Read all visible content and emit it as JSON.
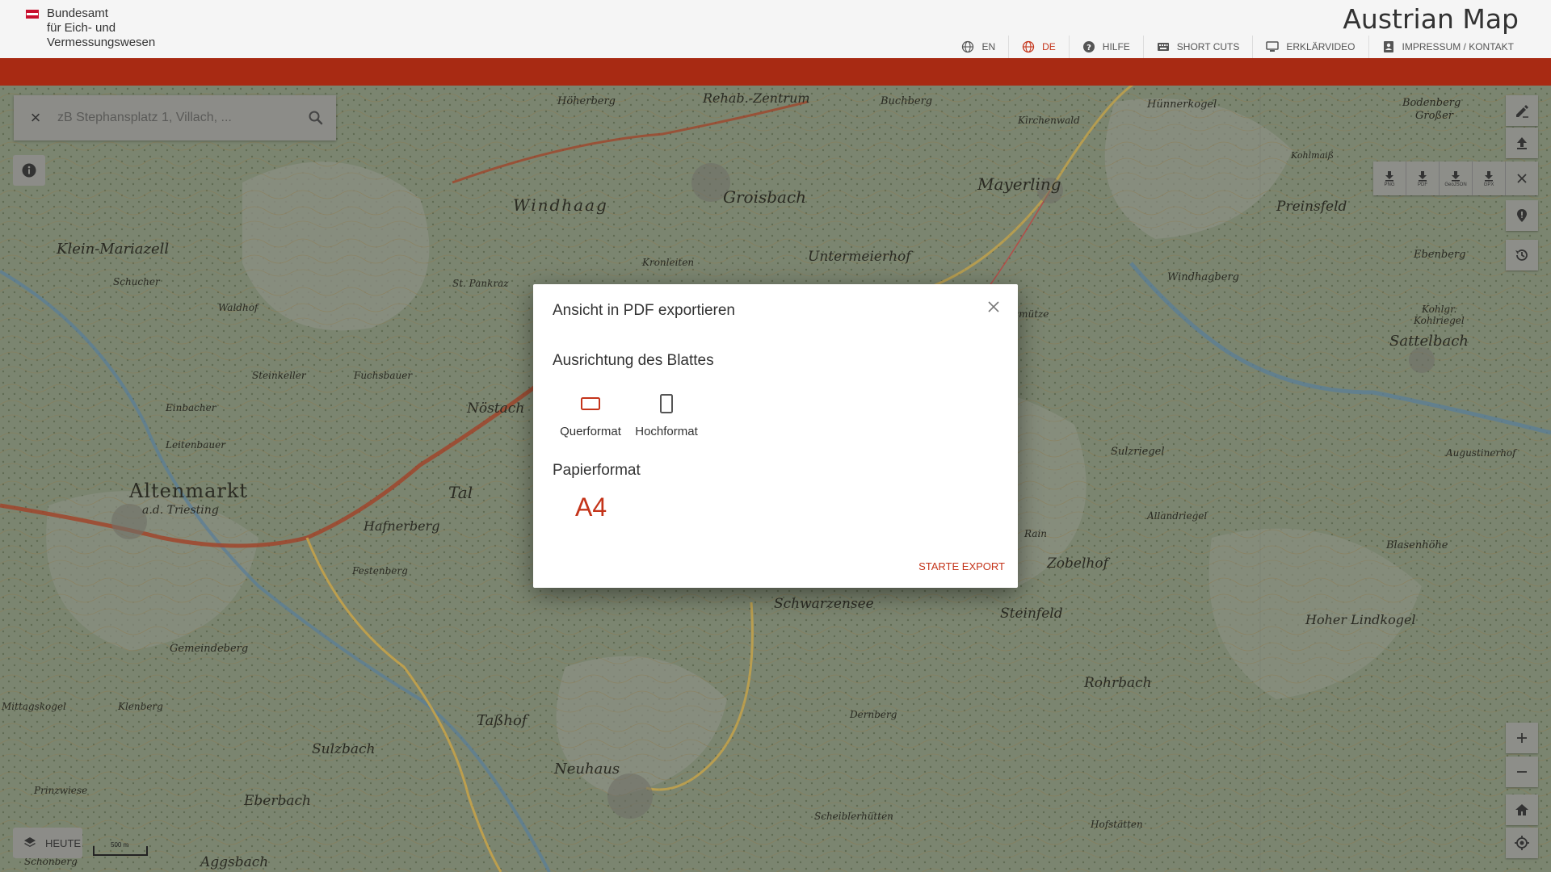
{
  "header": {
    "logo_lines": [
      "Bundesamt",
      "für Eich- und",
      "Vermessungswesen"
    ],
    "app_title": "Austrian Map",
    "nav": [
      {
        "label": "EN",
        "icon": "globe-icon",
        "active": false
      },
      {
        "label": "DE",
        "icon": "globe-icon",
        "active": true
      },
      {
        "label": "HILFE",
        "icon": "help-icon",
        "active": false
      },
      {
        "label": "SHORT CUTS",
        "icon": "keyboard-icon",
        "active": false
      },
      {
        "label": "ERKLÄRVIDEO",
        "icon": "monitor-icon",
        "active": false
      },
      {
        "label": "IMPRESSUM / KONTAKT",
        "icon": "contact-icon",
        "active": false
      }
    ]
  },
  "search": {
    "placeholder": "zB Stephansplatz 1, Villach, ..."
  },
  "export_formats": [
    "PNG",
    "PDF",
    "GeoJSON",
    "GPX"
  ],
  "map": {
    "labels": [
      "Höherberg",
      "Rehab.-Zentrum",
      "Buchberg",
      "Hünnerkogel",
      "Kirchenwald",
      "Windhaag",
      "Groisbach",
      "Mayerling",
      "Preinsfeld",
      "Klein-Mariazell",
      "Kronleiten",
      "Untermeierhof",
      "Windhagberg",
      "Sattelbach",
      "Schucher",
      "Waldhof",
      "St. Pankraz",
      "Bischofsmütze",
      "Steinkeller",
      "Fuchsbauer",
      "Nöstach",
      "Einbacher",
      "Leitenbauer",
      "Altenmarkt",
      "a.d. Triesting",
      "Hafnerberg",
      "Festenberg",
      "Tal",
      "Sulzriegel",
      "Augustinerhof",
      "Allandriegel",
      "Blasenhöhe",
      "Schwarzensee",
      "Steinfeld",
      "Hoher Lindkogel",
      "Gemeindeberg",
      "Klenberg",
      "Taßhof",
      "Rohrbach",
      "Dernberg",
      "Sulzbach",
      "Neuhaus",
      "Eberbach",
      "Aggsbach",
      "Schönberg",
      "Mittagskogel",
      "Prinzwiese",
      "Scheiblerhütten",
      "Hofstätten",
      "Ebenberg",
      "Bodenberg",
      "Großer",
      "Kohlmaiß",
      "Kohlgr.",
      "Kohlriegel",
      "Zobelhof",
      "Rain"
    ]
  },
  "map_tools": {
    "heute_label": "HEUTE",
    "scale_label": "500 m"
  },
  "dialog": {
    "title": "Ansicht in PDF exportieren",
    "orientation_heading": "Ausrichtung des Blattes",
    "orientation_options": [
      {
        "label": "Querformat",
        "selected": true
      },
      {
        "label": "Hochformat",
        "selected": false
      }
    ],
    "paper_heading": "Papierformat",
    "paper_value": "A4",
    "start_button": "STARTE EXPORT"
  },
  "colors": {
    "accent": "#c4341a",
    "redbar": "#a82a13"
  }
}
